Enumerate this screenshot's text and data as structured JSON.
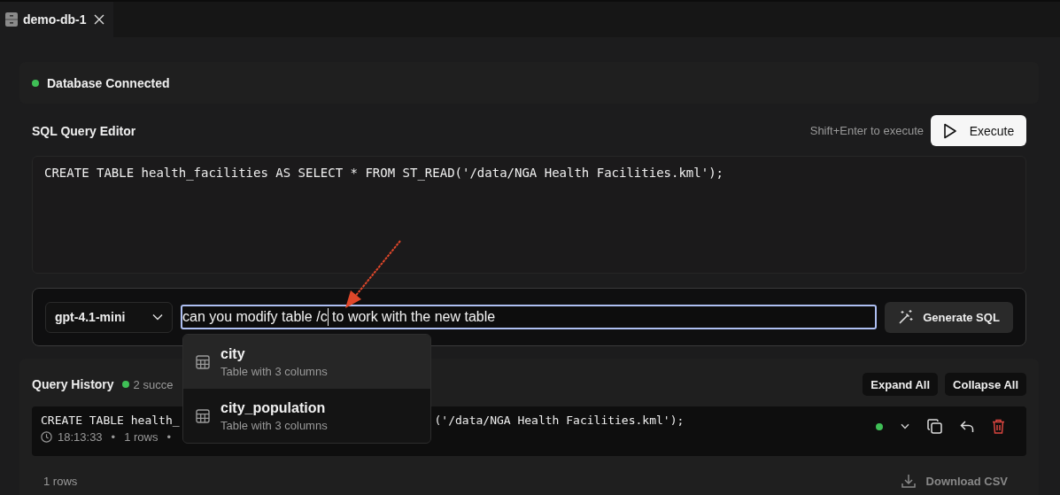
{
  "tabs": [
    {
      "label": "demo-db-1",
      "selected": true
    }
  ],
  "connection": {
    "status": "Database Connected",
    "connected": true
  },
  "editor": {
    "title": "SQL Query Editor",
    "hint": "Shift+Enter to execute",
    "execute_label": "Execute",
    "query": "CREATE TABLE health_facilities AS SELECT * FROM ST_READ('/data/NGA Health Facilities.kml');"
  },
  "assistant": {
    "model": "gpt-4.1-mini",
    "prompt_before_cursor": "can you modify table /c",
    "prompt_after_cursor": " to work with the new table",
    "generate_label": "Generate SQL",
    "suggestions": [
      {
        "name": "city",
        "detail": "Table with 3 columns",
        "selected": true
      },
      {
        "name": "city_population",
        "detail": "Table with 3 columns",
        "selected": false
      }
    ]
  },
  "history": {
    "title": "Query History",
    "summary": "2 succe",
    "expand_label": "Expand All",
    "collapse_label": "Collapse All",
    "entries": [
      {
        "sql_start": "CREATE TABLE health_",
        "sql_end": "('/data/NGA Health Facilities.kml');",
        "time": "18:13:33",
        "separator": "•",
        "rows": "1 rows",
        "separator_2": "•",
        "success": true
      }
    ],
    "result_rows": "1 rows",
    "download_label": "Download CSV"
  }
}
